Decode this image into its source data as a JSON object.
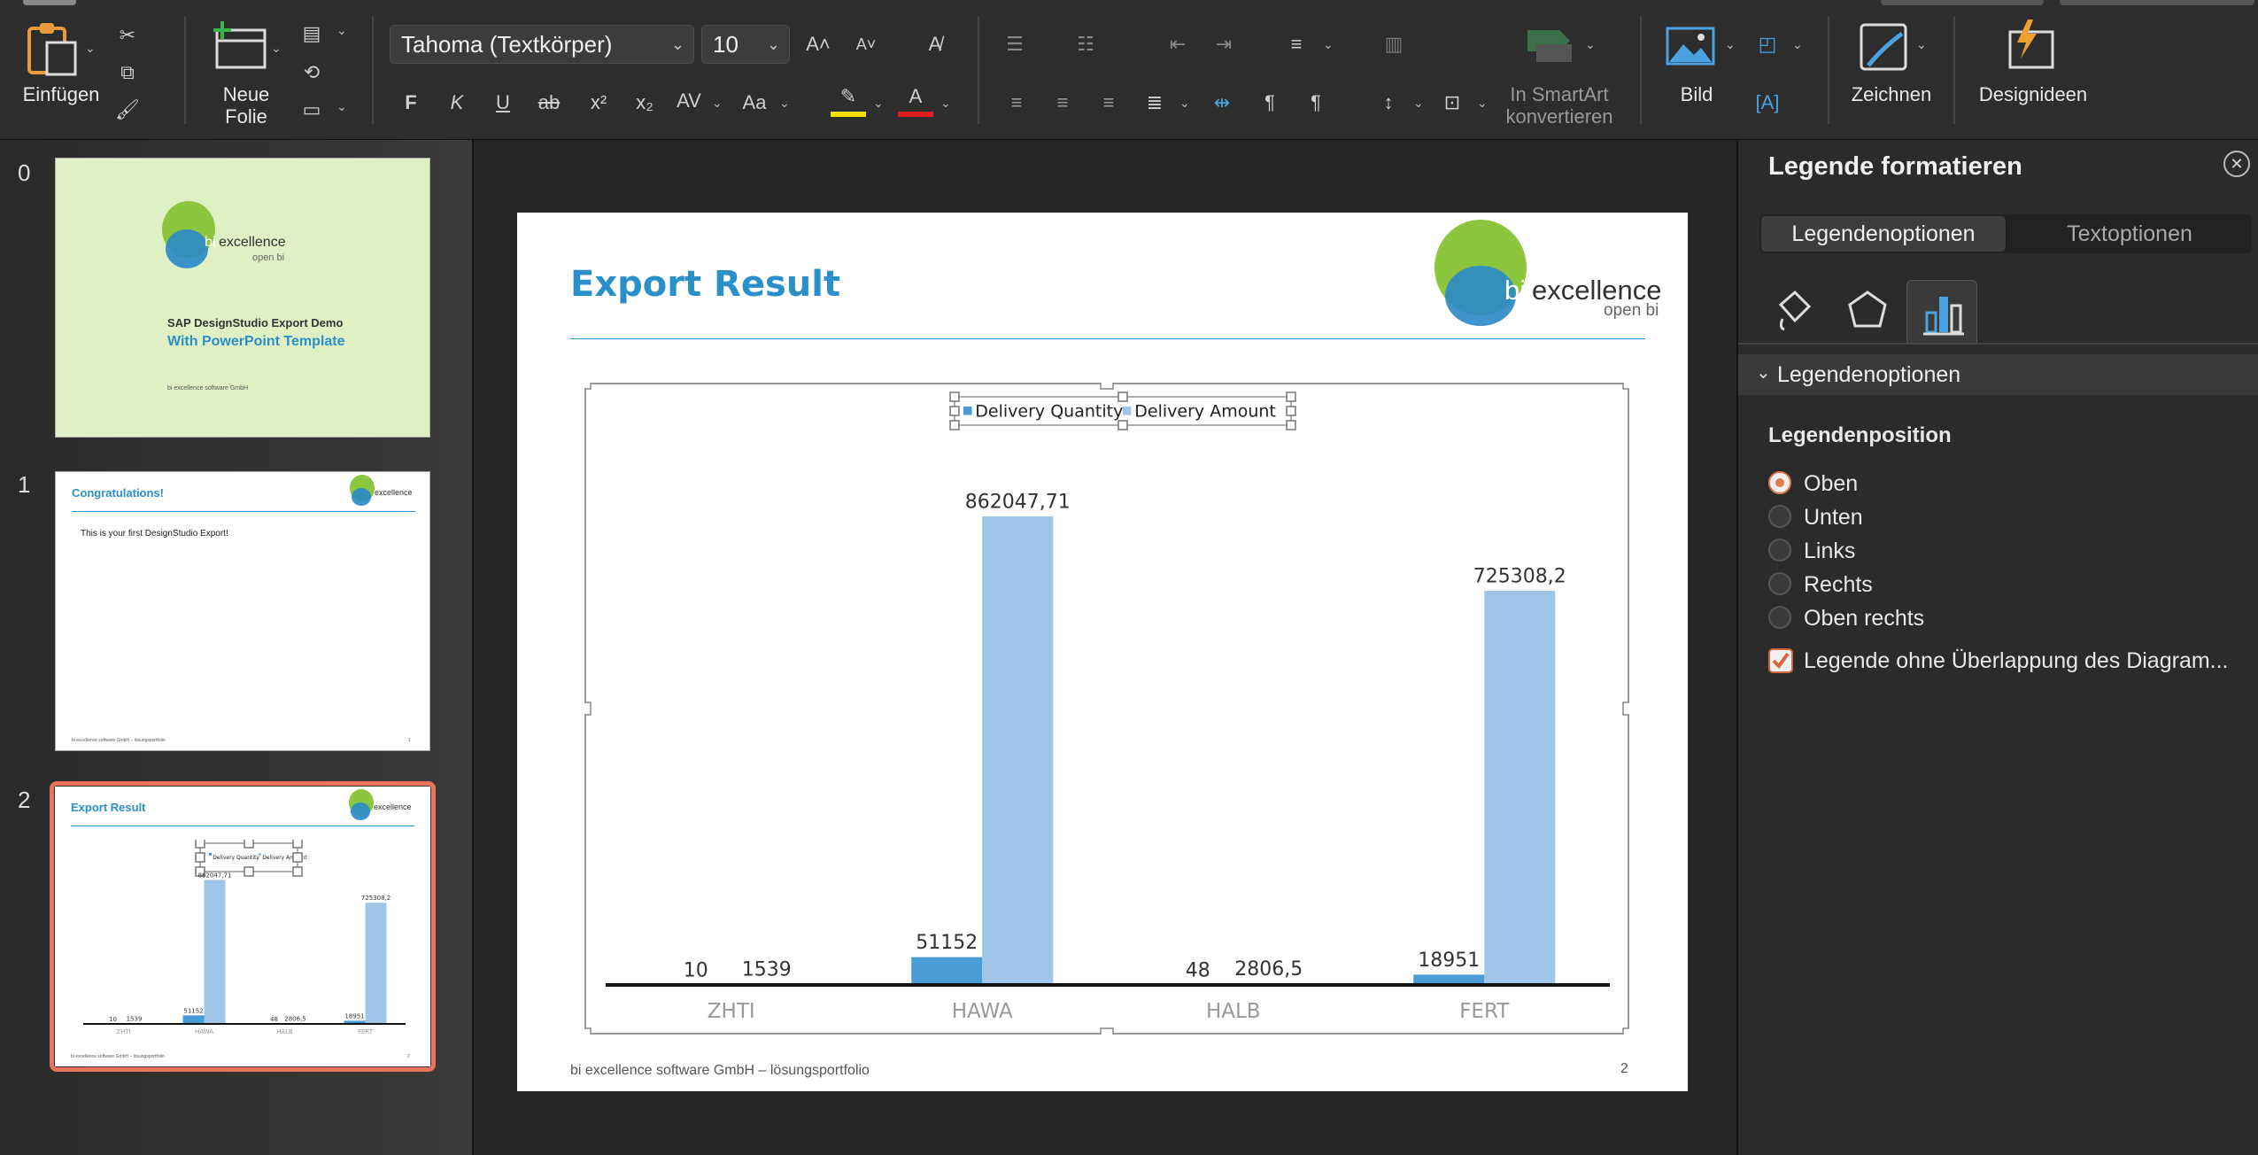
{
  "ribbon": {
    "paste_label": "Einfügen",
    "new_slide_label": "Neue",
    "new_slide_label2": "Folie",
    "font_name": "Tahoma (Textkörper)",
    "font_size": "10",
    "bold": "F",
    "italic": "K",
    "underline": "U",
    "strike": "ab",
    "superscript": "x²",
    "subscript": "x₂",
    "char_spacing": "AV",
    "change_case": "Aa",
    "smartart_label1": "In SmartArt",
    "smartart_label2": "konvertieren",
    "picture_label": "Bild",
    "draw_label": "Zeichnen",
    "designideas_label": "Designideen"
  },
  "thumbnails": [
    {
      "num": "0",
      "subtitle1": "SAP DesignStudio Export Demo",
      "subtitle2": "With PowerPoint Template",
      "footer": "bi excellence software GmbH"
    },
    {
      "num": "1",
      "title": "Congratulations!",
      "body": "This is your first DesignStudio Export!",
      "footer": "bi excellence software GmbH – lösungsportfolio",
      "page": "1"
    },
    {
      "num": "2",
      "title": "Export Result",
      "footer": "bi excellence software GmbH – lösungsportfolio",
      "page": "2"
    }
  ],
  "logo": {
    "bi": "bi",
    "excellence": "excellence",
    "openbi": "open bi"
  },
  "slide": {
    "title": "Export Result",
    "footer": "bi excellence software GmbH – lösungsportfolio",
    "page_number": "2"
  },
  "chart_data": {
    "type": "bar",
    "categories": [
      "ZHTI",
      "HAWA",
      "HALB",
      "FERT"
    ],
    "series": [
      {
        "name": "Delivery Quantity",
        "values": [
          10,
          51152,
          48,
          18951
        ],
        "labels": [
          "10",
          "51152",
          "48",
          "18951"
        ],
        "color": "#4a9cd6"
      },
      {
        "name": "Delivery Amount",
        "values": [
          1539,
          862047.71,
          2806.5,
          725308.2
        ],
        "labels": [
          "1539",
          "862047,71",
          "2806,5",
          "725308,2"
        ],
        "color": "#9fc5e8"
      }
    ],
    "ylim": [
      0,
      880000
    ],
    "legend_position": "top",
    "grid": false
  },
  "pane": {
    "title": "Legende formatieren",
    "tab_legend": "Legendenoptionen",
    "tab_text": "Textoptionen",
    "section": "Legendenoptionen",
    "position_heading": "Legendenposition",
    "options": [
      "Oben",
      "Unten",
      "Links",
      "Rechts",
      "Oben rechts"
    ],
    "selected": "Oben",
    "checkbox_label": "Legende ohne Überlappung des Diagram...",
    "checkbox_checked": true
  },
  "colors": {
    "accent": "#2b8fc9",
    "selection": "#e8745c",
    "checkbox": "#d9683e"
  }
}
